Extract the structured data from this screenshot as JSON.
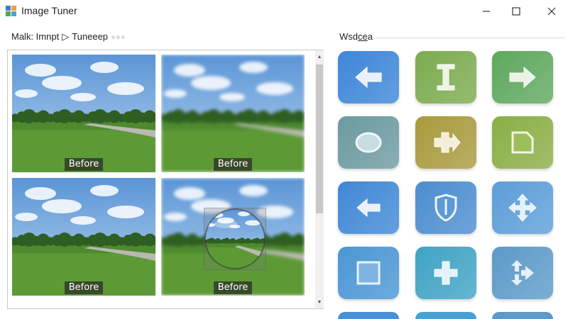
{
  "window": {
    "title": "Image Tuner",
    "minimize_label": "minimize",
    "maximize_label": "maximize",
    "close_label": "close"
  },
  "left_panel": {
    "breadcrumb": [
      "Malk: Imnpt",
      "Tuneeep"
    ],
    "separator": "▷",
    "thumbnails": [
      {
        "label": "Before",
        "blurred": false,
        "has_lens": false
      },
      {
        "label": "Before",
        "blurred": true,
        "has_lens": false
      },
      {
        "label": "Before",
        "blurred": false,
        "has_lens": false
      },
      {
        "label": "Before",
        "blurred": true,
        "has_lens": true
      }
    ]
  },
  "right_panel": {
    "title_prefix": "Wsd",
    "title_underlined": "ce",
    "title_suffix": "a",
    "tiles": [
      {
        "icon": "arrow-left-icon",
        "color": "#3d86d8"
      },
      {
        "icon": "text-cursor-icon",
        "color": "#7bab4f"
      },
      {
        "icon": "arrow-right-icon",
        "color": "#5ea85e"
      },
      {
        "icon": "circle-icon",
        "color": "#6b9aa0"
      },
      {
        "icon": "plus-arrow-icon",
        "color": "#a89a3c"
      },
      {
        "icon": "frame-icon",
        "color": "#8aae45"
      },
      {
        "icon": "arrow-left-icon",
        "color": "#3f88d6"
      },
      {
        "icon": "shield-icon",
        "color": "#4b8dcf"
      },
      {
        "icon": "move-arrows-icon",
        "color": "#5c9ed8"
      },
      {
        "icon": "square-icon",
        "color": "#4a96d4"
      },
      {
        "icon": "plus-icon",
        "color": "#3fa3c4"
      },
      {
        "icon": "swap-arrows-icon",
        "color": "#5c9ac8"
      }
    ]
  },
  "colors": {
    "sky": "#6fa6dc",
    "grass": "#4e8a2e",
    "trees": "#2f5e23",
    "road": "#b9b9b0"
  }
}
